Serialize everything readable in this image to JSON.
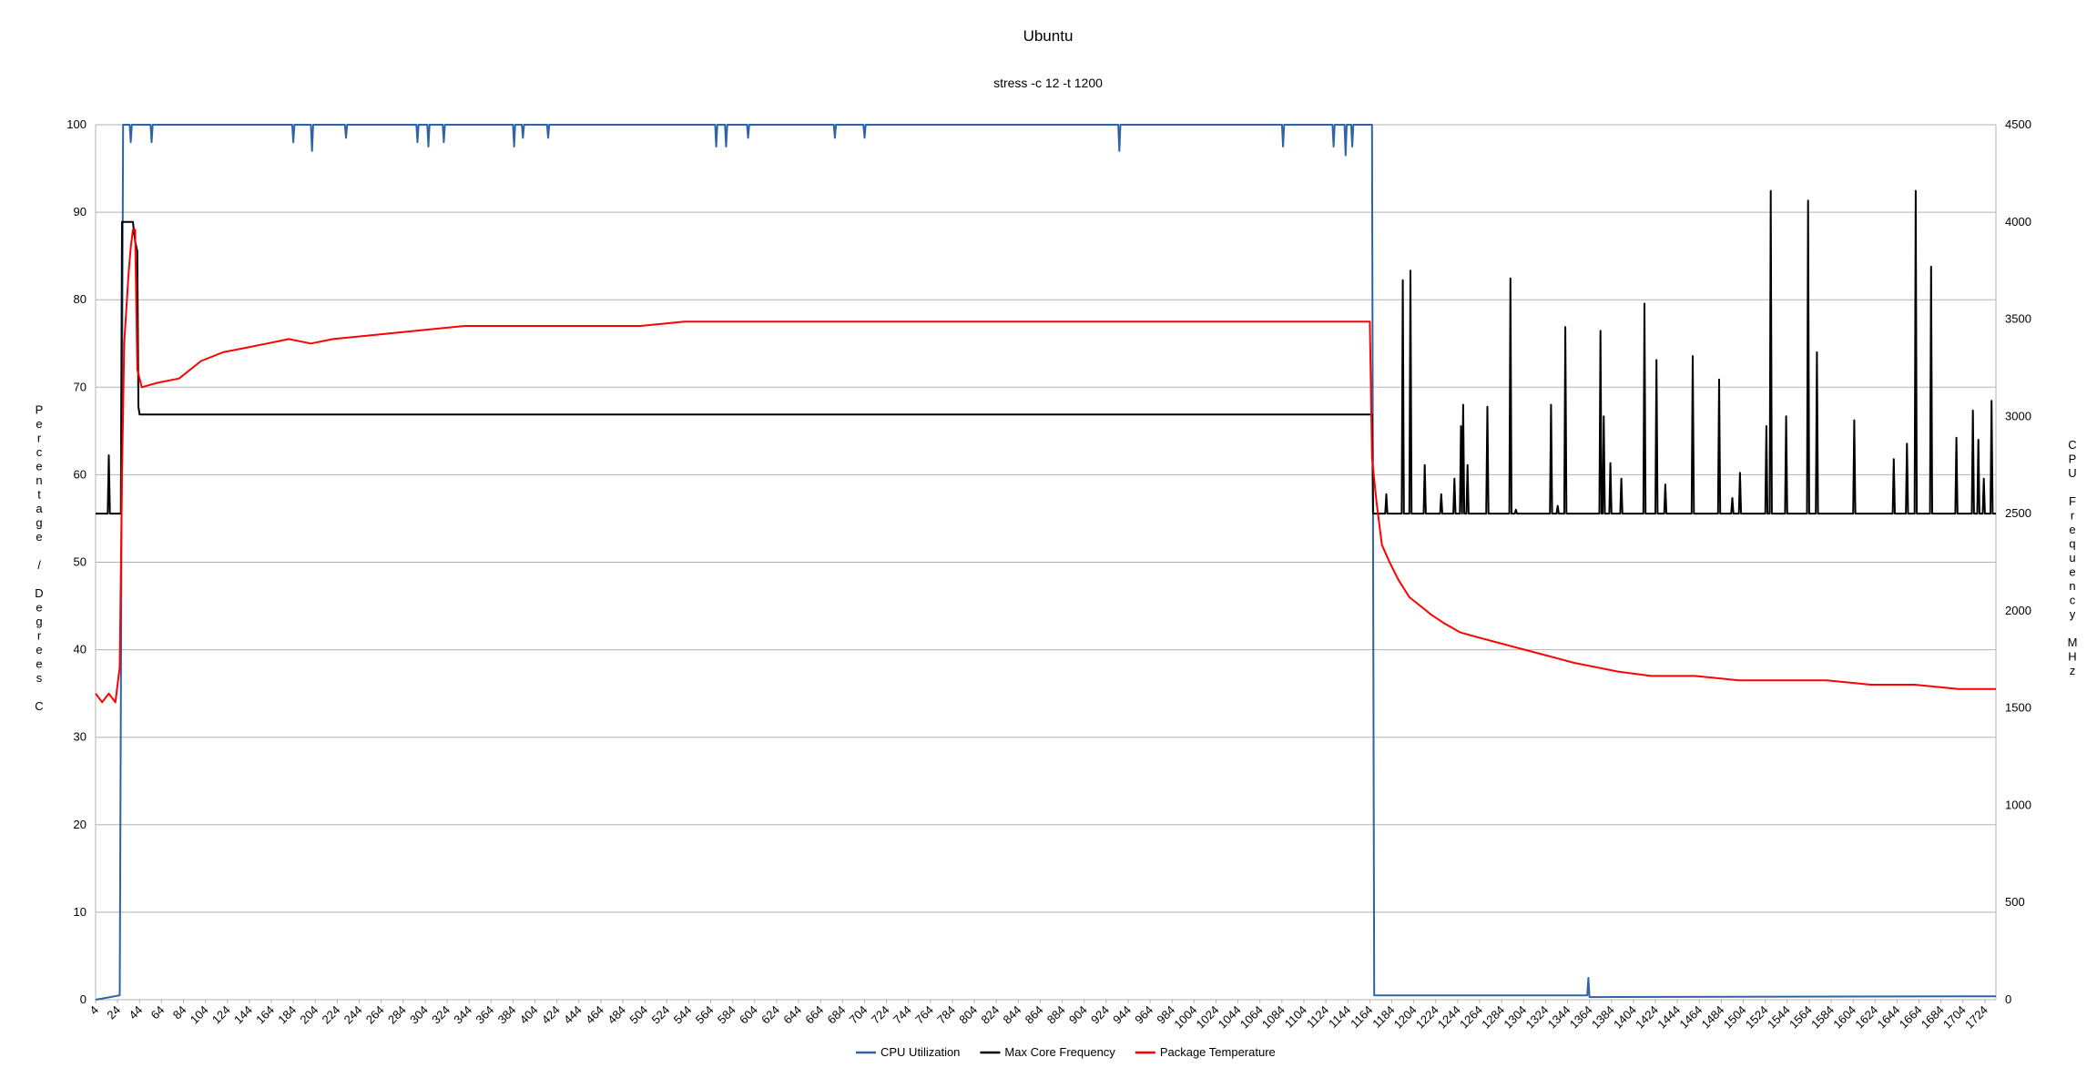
{
  "chart_data": {
    "type": "line",
    "title": "Ubuntu",
    "subtitle": "stress -c 12 -t 1200",
    "ylabel": "Percentage / Degrees C",
    "y2label": "CPU Frequency MHz",
    "xlabel": "",
    "ylim": [
      0,
      100
    ],
    "y2lim": [
      0,
      4500
    ],
    "xlim": [
      4,
      1734
    ],
    "grid": true,
    "legend_position": "bottom",
    "yticks": [
      "0",
      "10",
      "20",
      "30",
      "40",
      "50",
      "60",
      "70",
      "80",
      "90",
      "100"
    ],
    "y2ticks": [
      "0",
      "500",
      "1000",
      "1500",
      "2000",
      "2500",
      "3000",
      "3500",
      "4000",
      "4500"
    ],
    "xticks": [
      "4",
      "24",
      "44",
      "64",
      "84",
      "104",
      "124",
      "144",
      "164",
      "184",
      "204",
      "224",
      "244",
      "264",
      "284",
      "304",
      "324",
      "344",
      "364",
      "384",
      "404",
      "424",
      "444",
      "464",
      "484",
      "504",
      "524",
      "544",
      "564",
      "584",
      "604",
      "624",
      "644",
      "664",
      "684",
      "704",
      "724",
      "744",
      "764",
      "784",
      "804",
      "824",
      "844",
      "864",
      "884",
      "904",
      "924",
      "944",
      "964",
      "984",
      "1004",
      "1024",
      "1044",
      "1064",
      "1084",
      "1104",
      "1124",
      "1144",
      "1164",
      "1184",
      "1204",
      "1224",
      "1244",
      "1264",
      "1284",
      "1304",
      "1324",
      "1344",
      "1364",
      "1384",
      "1404",
      "1424",
      "1444",
      "1464",
      "1484",
      "1504",
      "1524",
      "1544",
      "1564",
      "1584",
      "1604",
      "1624",
      "1644",
      "1664",
      "1684",
      "1704",
      "1724"
    ],
    "series": [
      {
        "name": "CPU Utilization",
        "axis": "left",
        "color": "#2e64a4",
        "points": [
          [
            4,
            0
          ],
          [
            26,
            0.5
          ],
          [
            29,
            100
          ],
          [
            35,
            100
          ],
          [
            36,
            98
          ],
          [
            37,
            100
          ],
          [
            54,
            100
          ],
          [
            55,
            98
          ],
          [
            56,
            100
          ],
          [
            183,
            100
          ],
          [
            184,
            98
          ],
          [
            185,
            100
          ],
          [
            200,
            100
          ],
          [
            201,
            97
          ],
          [
            202,
            100
          ],
          [
            231,
            100
          ],
          [
            232,
            98.5
          ],
          [
            233,
            100
          ],
          [
            296,
            100
          ],
          [
            297,
            98
          ],
          [
            298,
            100
          ],
          [
            306,
            100
          ],
          [
            307,
            97.5
          ],
          [
            308,
            100
          ],
          [
            320,
            100
          ],
          [
            321,
            98
          ],
          [
            322,
            100
          ],
          [
            384,
            100
          ],
          [
            385,
            97.5
          ],
          [
            386,
            100
          ],
          [
            392,
            100
          ],
          [
            393,
            98.5
          ],
          [
            394,
            100
          ],
          [
            415,
            100
          ],
          [
            416,
            98.5
          ],
          [
            417,
            100
          ],
          [
            568,
            100
          ],
          [
            569,
            97.5
          ],
          [
            570,
            100
          ],
          [
            577,
            100
          ],
          [
            578,
            97.5
          ],
          [
            579,
            100
          ],
          [
            597,
            100
          ],
          [
            598,
            98.5
          ],
          [
            599,
            100
          ],
          [
            676,
            100
          ],
          [
            677,
            98.5
          ],
          [
            678,
            100
          ],
          [
            703,
            100
          ],
          [
            704,
            98.5
          ],
          [
            705,
            100
          ],
          [
            935,
            100
          ],
          [
            936,
            97
          ],
          [
            937,
            100
          ],
          [
            1084,
            100
          ],
          [
            1085,
            97.5
          ],
          [
            1086,
            100
          ],
          [
            1130,
            100
          ],
          [
            1131,
            97.5
          ],
          [
            1132,
            100
          ],
          [
            1141,
            100
          ],
          [
            1142,
            96.5
          ],
          [
            1143,
            100
          ],
          [
            1147,
            100
          ],
          [
            1148,
            97.5
          ],
          [
            1149,
            100
          ],
          [
            1166,
            100
          ],
          [
            1168,
            0.5
          ],
          [
            1362,
            0.5
          ],
          [
            1363,
            2.5
          ],
          [
            1364,
            0.3
          ],
          [
            1734,
            0.4
          ]
        ]
      },
      {
        "name": "Max Core Frequency",
        "axis": "right",
        "color": "#000000",
        "points": [
          [
            4,
            2500
          ],
          [
            15,
            2500
          ],
          [
            16,
            2800
          ],
          [
            17,
            2500
          ],
          [
            27,
            2500
          ],
          [
            28,
            4000
          ],
          [
            38,
            4000
          ],
          [
            40,
            3900
          ],
          [
            42,
            3850
          ],
          [
            43,
            3050
          ],
          [
            44,
            3010
          ],
          [
            1166,
            3010
          ],
          [
            1167,
            2500
          ],
          [
            1178,
            2500
          ],
          [
            1179,
            2600
          ],
          [
            1180,
            2500
          ],
          [
            1193,
            2500
          ],
          [
            1194,
            3700
          ],
          [
            1195,
            2500
          ],
          [
            1200,
            2500
          ],
          [
            1201,
            3750
          ],
          [
            1202,
            2500
          ],
          [
            1213,
            2500
          ],
          [
            1214,
            2750
          ],
          [
            1215,
            2500
          ],
          [
            1228,
            2500
          ],
          [
            1229,
            2600
          ],
          [
            1230,
            2500
          ],
          [
            1240,
            2500
          ],
          [
            1241,
            2680
          ],
          [
            1242,
            2500
          ],
          [
            1246,
            2500
          ],
          [
            1247,
            2950
          ],
          [
            1248,
            2500
          ],
          [
            1249,
            3060
          ],
          [
            1250,
            2500
          ],
          [
            1252,
            2500
          ],
          [
            1253,
            2750
          ],
          [
            1254,
            2500
          ],
          [
            1270,
            2500
          ],
          [
            1271,
            3050
          ],
          [
            1272,
            2500
          ],
          [
            1291,
            2500
          ],
          [
            1292,
            3710
          ],
          [
            1293,
            2500
          ],
          [
            1296,
            2500
          ],
          [
            1297,
            2520
          ],
          [
            1298,
            2500
          ],
          [
            1328,
            2500
          ],
          [
            1329,
            3060
          ],
          [
            1330,
            2500
          ],
          [
            1334,
            2500
          ],
          [
            1335,
            2540
          ],
          [
            1336,
            2500
          ],
          [
            1341,
            2500
          ],
          [
            1342,
            3460
          ],
          [
            1343,
            2500
          ],
          [
            1373,
            2500
          ],
          [
            1374,
            3440
          ],
          [
            1375,
            2500
          ],
          [
            1376,
            2500
          ],
          [
            1377,
            3000
          ],
          [
            1378,
            2500
          ],
          [
            1382,
            2500
          ],
          [
            1383,
            2760
          ],
          [
            1384,
            2500
          ],
          [
            1392,
            2500
          ],
          [
            1393,
            2680
          ],
          [
            1394,
            2500
          ],
          [
            1413,
            2500
          ],
          [
            1414,
            3580
          ],
          [
            1415,
            2500
          ],
          [
            1424,
            2500
          ],
          [
            1425,
            3290
          ],
          [
            1426,
            2500
          ],
          [
            1432,
            2500
          ],
          [
            1433,
            2650
          ],
          [
            1434,
            2500
          ],
          [
            1457,
            2500
          ],
          [
            1458,
            3310
          ],
          [
            1459,
            2500
          ],
          [
            1481,
            2500
          ],
          [
            1482,
            3190
          ],
          [
            1483,
            2500
          ],
          [
            1493,
            2500
          ],
          [
            1494,
            2580
          ],
          [
            1495,
            2500
          ],
          [
            1500,
            2500
          ],
          [
            1501,
            2710
          ],
          [
            1502,
            2500
          ],
          [
            1524,
            2500
          ],
          [
            1525,
            2950
          ],
          [
            1526,
            2500
          ],
          [
            1528,
            2500
          ],
          [
            1529,
            4160
          ],
          [
            1530,
            2500
          ],
          [
            1542,
            2500
          ],
          [
            1543,
            3000
          ],
          [
            1544,
            2500
          ],
          [
            1562,
            2500
          ],
          [
            1563,
            4110
          ],
          [
            1564,
            2500
          ],
          [
            1570,
            2500
          ],
          [
            1571,
            3330
          ],
          [
            1572,
            2500
          ],
          [
            1604,
            2500
          ],
          [
            1605,
            2980
          ],
          [
            1606,
            2500
          ],
          [
            1640,
            2500
          ],
          [
            1641,
            2780
          ],
          [
            1642,
            2500
          ],
          [
            1652,
            2500
          ],
          [
            1653,
            2860
          ],
          [
            1654,
            2500
          ],
          [
            1660,
            2500
          ],
          [
            1661,
            4160
          ],
          [
            1662,
            2500
          ],
          [
            1674,
            2500
          ],
          [
            1675,
            3770
          ],
          [
            1676,
            2500
          ],
          [
            1697,
            2500
          ],
          [
            1698,
            2890
          ],
          [
            1699,
            2500
          ],
          [
            1712,
            2500
          ],
          [
            1713,
            3030
          ],
          [
            1714,
            2500
          ],
          [
            1717,
            2500
          ],
          [
            1718,
            2880
          ],
          [
            1719,
            2500
          ],
          [
            1722,
            2500
          ],
          [
            1723,
            2680
          ],
          [
            1724,
            2500
          ],
          [
            1729,
            2500
          ],
          [
            1730,
            3080
          ],
          [
            1731,
            2500
          ],
          [
            1734,
            2500
          ]
        ]
      },
      {
        "name": "Package Temperature",
        "axis": "left",
        "color": "#ff0000",
        "points": [
          [
            4,
            35
          ],
          [
            10,
            34
          ],
          [
            16,
            35
          ],
          [
            22,
            34
          ],
          [
            26,
            38
          ],
          [
            28,
            60
          ],
          [
            30,
            75
          ],
          [
            32,
            79
          ],
          [
            34,
            83
          ],
          [
            36,
            86
          ],
          [
            38,
            88
          ],
          [
            40,
            88
          ],
          [
            42,
            72
          ],
          [
            46,
            70
          ],
          [
            60,
            70.5
          ],
          [
            80,
            71
          ],
          [
            100,
            73
          ],
          [
            120,
            74
          ],
          [
            140,
            74.5
          ],
          [
            160,
            75
          ],
          [
            180,
            75.5
          ],
          [
            200,
            75
          ],
          [
            220,
            75.5
          ],
          [
            260,
            76
          ],
          [
            300,
            76.5
          ],
          [
            340,
            77
          ],
          [
            380,
            77
          ],
          [
            420,
            77
          ],
          [
            460,
            77
          ],
          [
            500,
            77
          ],
          [
            540,
            77.5
          ],
          [
            580,
            77.5
          ],
          [
            620,
            77.5
          ],
          [
            660,
            77.5
          ],
          [
            700,
            77.5
          ],
          [
            740,
            77.5
          ],
          [
            780,
            77.5
          ],
          [
            820,
            77.5
          ],
          [
            860,
            77.5
          ],
          [
            900,
            77.5
          ],
          [
            940,
            77.5
          ],
          [
            980,
            77.5
          ],
          [
            1020,
            77.5
          ],
          [
            1060,
            77.5
          ],
          [
            1100,
            77.5
          ],
          [
            1140,
            77.5
          ],
          [
            1164,
            77.5
          ],
          [
            1166,
            62
          ],
          [
            1170,
            57
          ],
          [
            1175,
            52
          ],
          [
            1182,
            50
          ],
          [
            1190,
            48
          ],
          [
            1200,
            46
          ],
          [
            1210,
            45
          ],
          [
            1220,
            44
          ],
          [
            1232,
            43
          ],
          [
            1246,
            42
          ],
          [
            1260,
            41.5
          ],
          [
            1275,
            41
          ],
          [
            1290,
            40.5
          ],
          [
            1305,
            40
          ],
          [
            1320,
            39.5
          ],
          [
            1335,
            39
          ],
          [
            1350,
            38.5
          ],
          [
            1370,
            38
          ],
          [
            1390,
            37.5
          ],
          [
            1420,
            37
          ],
          [
            1460,
            37
          ],
          [
            1500,
            36.5
          ],
          [
            1540,
            36.5
          ],
          [
            1580,
            36.5
          ],
          [
            1620,
            36
          ],
          [
            1660,
            36
          ],
          [
            1700,
            35.5
          ],
          [
            1734,
            35.5
          ]
        ]
      }
    ]
  }
}
